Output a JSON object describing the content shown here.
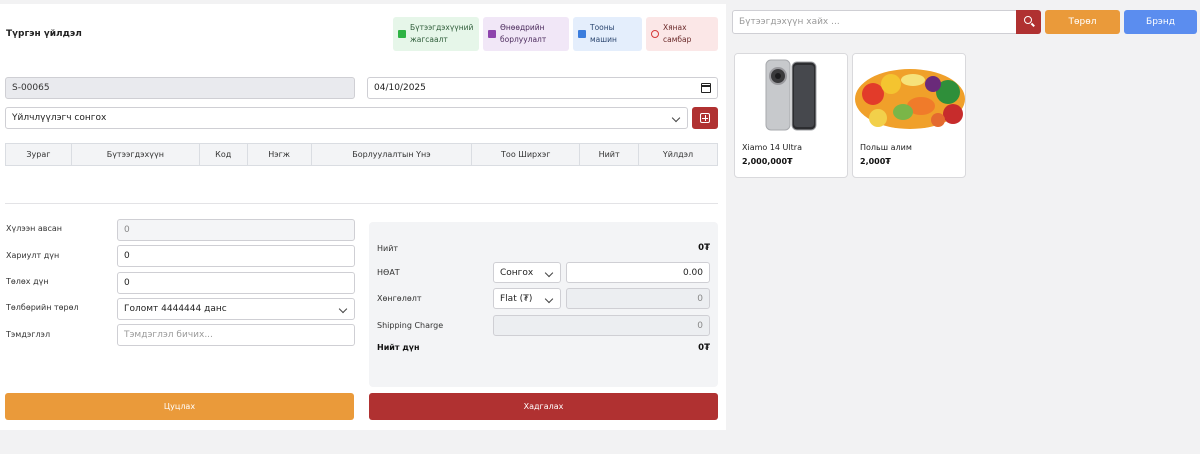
{
  "header": {
    "title": "Түргэн үйлдэл"
  },
  "quick_actions": [
    {
      "label": "Бүтээгдэхүүний жагсаалт",
      "icon": "cart-icon",
      "color": "#2fb344",
      "bg": "#e6f6e9"
    },
    {
      "label": "Өнөөдрийн борлуулалт",
      "icon": "bag-icon",
      "color": "#8e44ad",
      "bg": "#f1e7f7"
    },
    {
      "label": "Тооны машин",
      "icon": "calculator-icon",
      "color": "#3b7ddd",
      "bg": "#e4eefc"
    },
    {
      "label": "Хянах самбар",
      "icon": "power-icon",
      "color": "#d63939",
      "bg": "#fbe7e7"
    }
  ],
  "form": {
    "sale_number": "S-00065",
    "date": "04/10/2025",
    "customer_select": "Үйлчлүүлэгч сонгох"
  },
  "table": {
    "columns": [
      "Зураг",
      "Бүтээгдэхүүн",
      "Код",
      "Нэгж",
      "Борлуулалтын Үнэ",
      "Тоо Ширхэг",
      "Нийт",
      "Үйлдэл"
    ]
  },
  "payment": {
    "received_label": "Хүлээн авсан",
    "received_value": "0",
    "change_label": "Хариулт дүн",
    "change_value": "0",
    "pay_label": "Төлөх дүн",
    "pay_value": "0",
    "method_label": "Төлбөрийн төрөл",
    "method_value": "Голомт 4444444 данс",
    "note_label": "Тэмдэглэл",
    "note_placeholder": "Тэмдэглэл бичих..."
  },
  "summary": {
    "total_label": "Нийт",
    "total_value": "0₮",
    "vat_label": "НӨАТ",
    "vat_select": "Сонгох",
    "vat_value": "0.00",
    "discount_label": "Хөнгөлөлт",
    "discount_select": "Flat (₮)",
    "discount_value": "0",
    "shipping_label": "Shipping Charge",
    "shipping_value": "0",
    "grand_label": "Нийт дүн",
    "grand_value": "0₮"
  },
  "buttons": {
    "cancel": "Цуцлах",
    "save": "Хадгалах"
  },
  "search": {
    "placeholder": "Бүтээгдэхүүн хайх ..."
  },
  "filters": {
    "category": "Төрөл",
    "brand": "Брэнд"
  },
  "products": [
    {
      "name": "Xiamo 14 Ultra",
      "price": "2,000,000₮",
      "image": "phone-image"
    },
    {
      "name": "Польш алим",
      "price": "2,000₮",
      "image": "fruit-image"
    }
  ],
  "colors": {
    "primary_red": "#b03131",
    "orange": "#ea9a3a",
    "blue": "#5b8def"
  }
}
